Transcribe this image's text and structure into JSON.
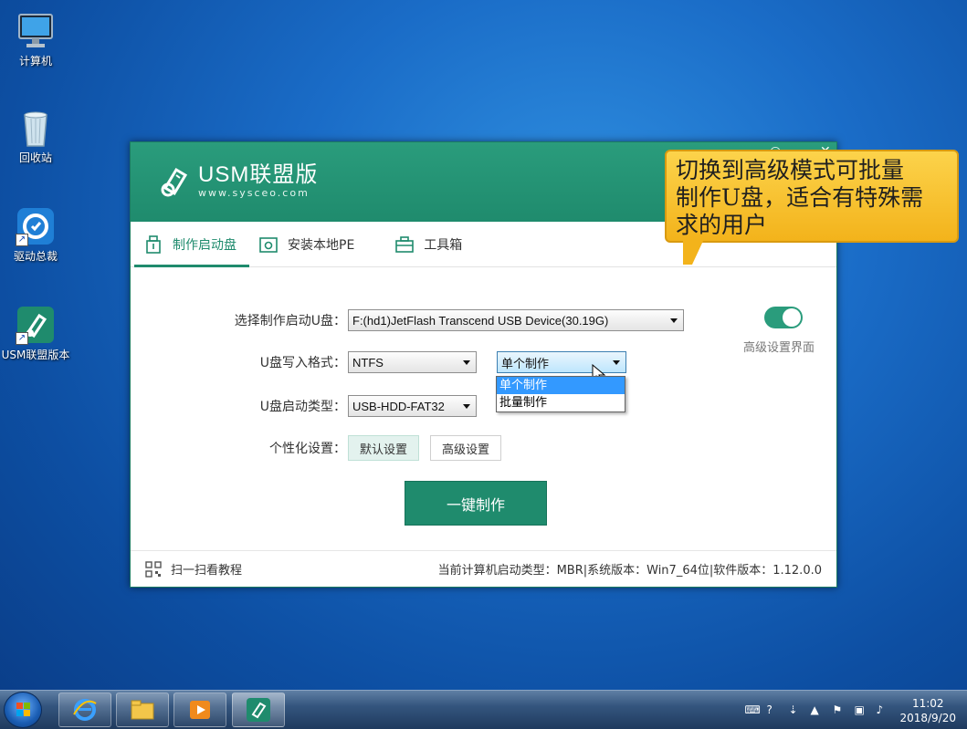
{
  "desktop": {
    "icons": [
      {
        "label": "计算机",
        "icon": "computer-icon"
      },
      {
        "label": "回收站",
        "icon": "recycle-bin-icon"
      },
      {
        "label": "驱动总裁",
        "icon": "driver-app-icon"
      },
      {
        "label": "USM联盟版本",
        "icon": "usm-app-icon"
      }
    ]
  },
  "app": {
    "logo_title": "USM联盟版",
    "logo_sub": "www.sysceo.com",
    "tabs": [
      {
        "label": "制作启动盘",
        "icon": "usb-icon",
        "active": true
      },
      {
        "label": "安装本地PE",
        "icon": "settings-box-icon",
        "active": false
      },
      {
        "label": "工具箱",
        "icon": "toolbox-icon",
        "active": false
      }
    ],
    "form": {
      "drive_label": "选择制作启动U盘：",
      "drive_value": "F:(hd1)JetFlash Transcend USB Device(30.19G)",
      "format_label": "U盘写入格式：",
      "format_value": "NTFS",
      "mode_value": "单个制作",
      "mode_options": [
        "单个制作",
        "批量制作"
      ],
      "boot_label": "U盘启动类型：",
      "boot_value": "USB-HDD-FAT32",
      "personal_label": "个性化设置：",
      "default_btn": "默认设置",
      "advanced_btn": "高级设置",
      "make_btn": "一键制作"
    },
    "advanced_toggle_label": "高级设置界面",
    "footer": {
      "tutorial": "扫一扫看教程",
      "info": "当前计算机启动类型：MBR|系统版本：Win7_64位|软件版本：1.12.0.0"
    },
    "accent_color": "#1f8b6d"
  },
  "callout": {
    "text_line1": "切换到高级模式可批量",
    "text_line2": "制作U盘，适合有特殊需",
    "text_line3": "求的用户"
  },
  "taskbar": {
    "items": [
      "ie-icon",
      "explorer-icon",
      "media-player-icon",
      "usm-app-icon"
    ],
    "time": "11:02",
    "date": "2018/9/20"
  }
}
